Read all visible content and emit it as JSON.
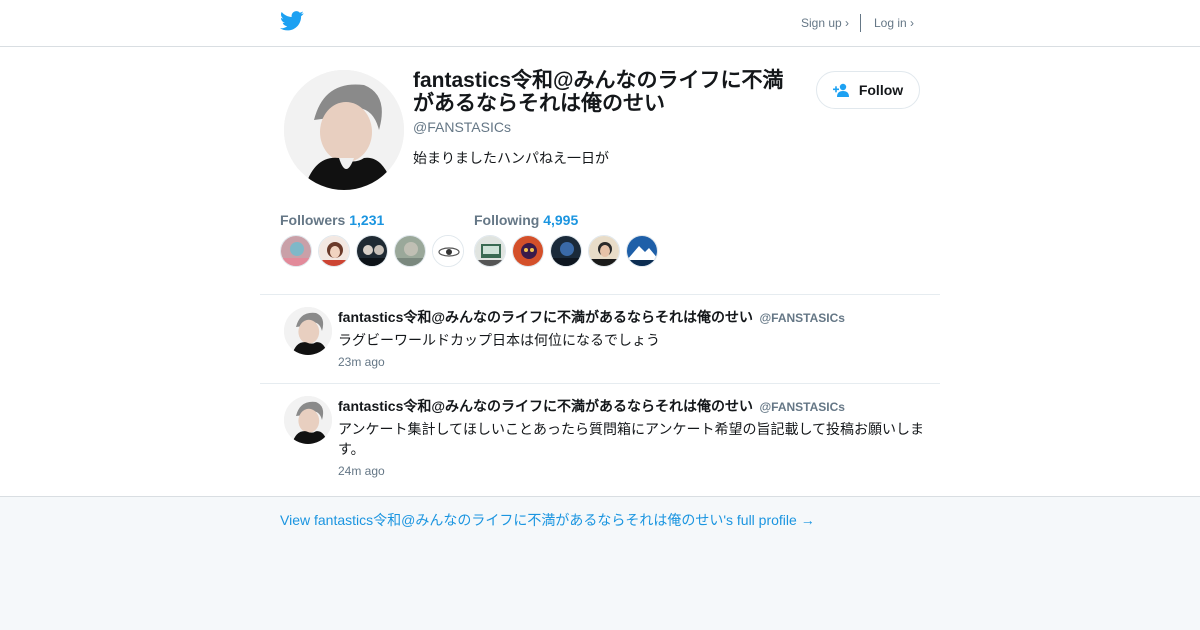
{
  "nav": {
    "signup_label": "Sign up ›",
    "login_label": "Log in ›",
    "logo_icon": "twitter-bird-icon"
  },
  "colors": {
    "brand_blue": "#1da1f2",
    "link_blue": "#1b95e0",
    "muted_gray": "#657786",
    "text_dark": "#14171a"
  },
  "profile": {
    "name": "fantastics令和@みんなのライフに不満があるならそれは俺のせい",
    "handle": "@FANSTASICs",
    "bio": "始まりましたハンパねえ一日が",
    "follow_label": "Follow",
    "follow_icon": "add-person-icon"
  },
  "stats": {
    "followers_label": "Followers",
    "followers_count": "1,231",
    "following_label": "Following",
    "following_count": "4,995"
  },
  "tweets": [
    {
      "name": "fantastics令和@みんなのライフに不満があるならそれは俺のせい",
      "handle": "@FANSTASICs",
      "text": "ラグビーワールドカップ日本は何位になるでしょう",
      "time": "23m ago"
    },
    {
      "name": "fantastics令和@みんなのライフに不満があるならそれは俺のせい",
      "handle": "@FANSTASICs",
      "text": "アンケート集計してほしいことあったら質問箱にアンケート希望の旨記載して投稿お願いします。",
      "time": "24m ago"
    }
  ],
  "footer": {
    "full_profile_link": "View fantastics令和@みんなのライフに不満があるならそれは俺のせい's full profile →"
  }
}
